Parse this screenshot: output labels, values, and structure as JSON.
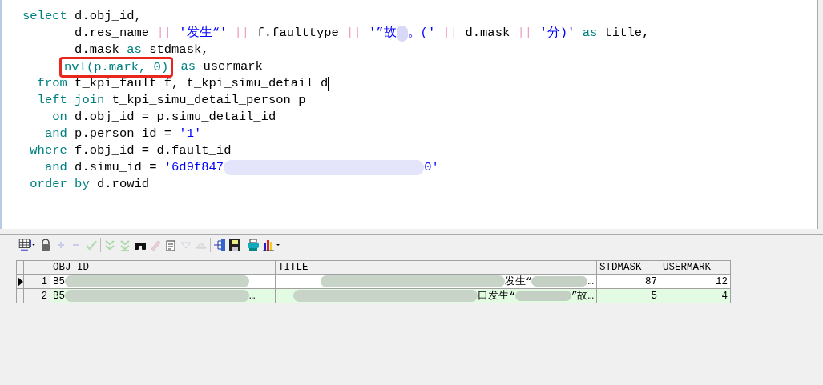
{
  "editor": {
    "lines": [
      [
        {
          "kind": "keyword",
          "text": "select"
        },
        {
          "kind": "plain",
          "text": " d.obj_id,"
        }
      ],
      [
        {
          "kind": "plain",
          "text": "       d.res_name "
        },
        {
          "kind": "operator",
          "text": "||"
        },
        {
          "kind": "string",
          "text": " '发生“' "
        },
        {
          "kind": "operator",
          "text": "||"
        },
        {
          "kind": "plain",
          "text": " f.faulttype "
        },
        {
          "kind": "operator",
          "text": "||"
        },
        {
          "kind": "string",
          "text": " '”故"
        },
        {
          "kind": "blur"
        },
        {
          "kind": "string",
          "text": "。(' "
        },
        {
          "kind": "operator",
          "text": "||"
        },
        {
          "kind": "plain",
          "text": " d.mask "
        },
        {
          "kind": "operator",
          "text": "||"
        },
        {
          "kind": "string",
          "text": " '分)'"
        },
        {
          "kind": "keyword",
          "text": " as"
        },
        {
          "kind": "plain",
          "text": " title,"
        }
      ],
      [
        {
          "kind": "plain",
          "text": "       d.mask "
        },
        {
          "kind": "keyword",
          "text": "as"
        },
        {
          "kind": "plain",
          "text": " stdmask,"
        }
      ],
      [
        {
          "kind": "highlight",
          "text": "nvl(p.mark, 0)"
        },
        {
          "kind": "keyword",
          "text": " as"
        },
        {
          "kind": "plain",
          "text": " usermark"
        }
      ],
      [
        {
          "kind": "keyword",
          "text": "  from"
        },
        {
          "kind": "plain",
          "text": " t_kpi_fault f, t_kpi_simu_detail d"
        },
        {
          "kind": "cursor"
        }
      ],
      [
        {
          "kind": "keyword",
          "text": "  left join"
        },
        {
          "kind": "plain",
          "text": " t_kpi_simu_detail_person p"
        }
      ],
      [
        {
          "kind": "keyword",
          "text": "    on"
        },
        {
          "kind": "plain",
          "text": " d.obj_id = p.simu_detail_id"
        }
      ],
      [
        {
          "kind": "keyword",
          "text": "   and"
        },
        {
          "kind": "plain",
          "text": " p.person_id = "
        },
        {
          "kind": "string",
          "text": "'1'"
        }
      ],
      [
        {
          "kind": "keyword",
          "text": " where"
        },
        {
          "kind": "plain",
          "text": " f.obj_id = d.fault_id"
        }
      ],
      [
        {
          "kind": "keyword",
          "text": "   and"
        },
        {
          "kind": "plain",
          "text": " d.simu_id = "
        },
        {
          "kind": "string",
          "text": "'6d9f847"
        },
        {
          "kind": "blur"
        },
        {
          "kind": "string",
          "text": "0'"
        }
      ],
      [
        {
          "kind": "keyword",
          "text": " order by"
        },
        {
          "kind": "plain",
          "text": " d.rowid"
        }
      ]
    ]
  },
  "grid": {
    "columns": [
      "OBJ_ID",
      "TITLE",
      "STDMASK",
      "USERMARK"
    ],
    "rows": [
      {
        "number": "1",
        "current": true,
        "obj_id": [
          {
            "kind": "plain",
            "text": "B5"
          },
          {
            "kind": "blur"
          }
        ],
        "title": [
          {
            "kind": "blur"
          },
          {
            "kind": "plain",
            "text": "发生“"
          },
          {
            "kind": "blur"
          },
          {
            "kind": "plain",
            "text": "…"
          }
        ],
        "stdmask": "87",
        "usermark": "12"
      },
      {
        "number": "2",
        "current": false,
        "obj_id": [
          {
            "kind": "plain",
            "text": "B5"
          },
          {
            "kind": "blur"
          },
          {
            "kind": "plain",
            "text": "…"
          }
        ],
        "title": [
          {
            "kind": "blur"
          },
          {
            "kind": "plain",
            "text": "口发生“"
          },
          {
            "kind": "blur"
          },
          {
            "kind": "plain",
            "text": "”故…"
          }
        ],
        "stdmask": "5",
        "usermark": "4"
      }
    ]
  }
}
